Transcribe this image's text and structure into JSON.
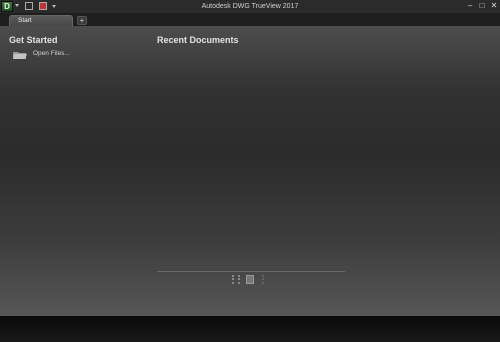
{
  "window": {
    "title": "Autodesk DWG TrueView 2017",
    "app_button_letter": "D",
    "controls": {
      "minimize": "–",
      "maximize": "□",
      "close": "✕"
    }
  },
  "tabs": {
    "start_label": "Start",
    "add_label": "+"
  },
  "start_page": {
    "get_started_title": "Get Started",
    "open_files_label": "Open Files...",
    "recent_documents_title": "Recent Documents"
  },
  "icons": {
    "app": "app-menu-icon",
    "quick_open": "open-folder-icon",
    "quick_plot": "plot-icon",
    "folder": "folder-icon"
  },
  "colors": {
    "accent": "#3d7d3d",
    "background": "#2b2b2b"
  }
}
